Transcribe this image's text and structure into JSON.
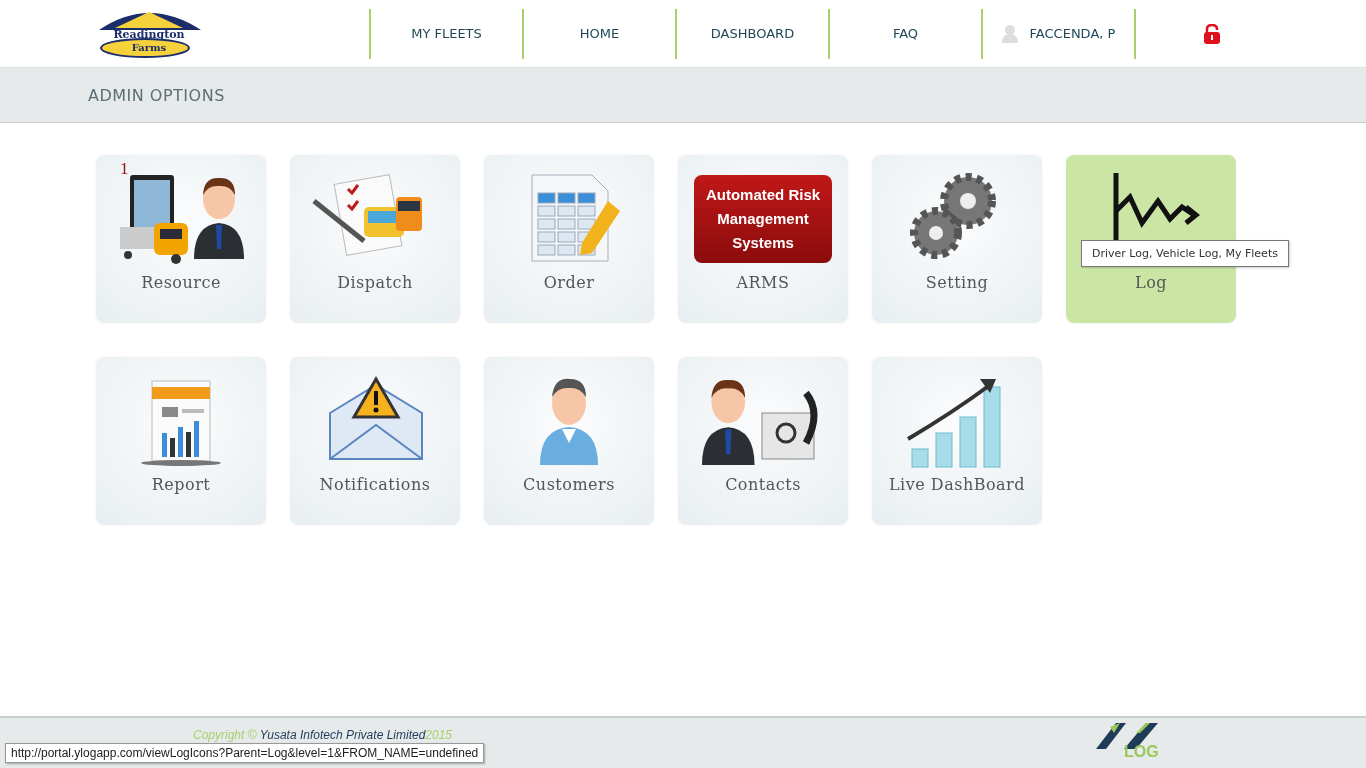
{
  "logo": {
    "line_1": "Readington",
    "line_2": "Farms"
  },
  "nav": [
    {
      "label": "MY FLEETS",
      "kind": "text"
    },
    {
      "label": "HOME",
      "kind": "text"
    },
    {
      "label": "DASHBOARD",
      "kind": "text"
    },
    {
      "label": "FAQ",
      "kind": "text"
    },
    {
      "label": "FACCENDA, P",
      "kind": "user"
    },
    {
      "kind": "lock"
    }
  ],
  "section_title": "ADMIN OPTIONS",
  "tiles": [
    {
      "label": "Resource",
      "kind": "resource",
      "badge": "1",
      "hovered": false
    },
    {
      "label": "Dispatch",
      "kind": "dispatch",
      "hovered": false
    },
    {
      "label": "Order",
      "kind": "order",
      "hovered": false
    },
    {
      "label": "ARMS",
      "kind": "arms",
      "icon_text": "Automated Risk Management Systems",
      "hovered": false
    },
    {
      "label": "Setting",
      "kind": "setting",
      "hovered": false
    },
    {
      "label": "Log",
      "kind": "log",
      "hovered": true,
      "tooltip": "Driver Log, Vehicle Log, My Fleets"
    },
    {
      "label": "Report",
      "kind": "report",
      "hovered": false
    },
    {
      "label": "Notifications",
      "kind": "notifications",
      "hovered": false
    },
    {
      "label": "Customers",
      "kind": "customers",
      "hovered": false
    },
    {
      "label": "Contacts",
      "kind": "contacts",
      "hovered": false
    },
    {
      "label": "Live DashBoard",
      "kind": "chart",
      "hovered": false
    }
  ],
  "footer": {
    "copyright": "Copyright ©",
    "company": "Yusata Infotech Private Limited",
    "year": "2015",
    "logo_text": "LOG"
  },
  "status_url": "http://portal.ylogapp.com/viewLogIcons?Parent=Log&level=1&FROM_NAME=undefined"
}
